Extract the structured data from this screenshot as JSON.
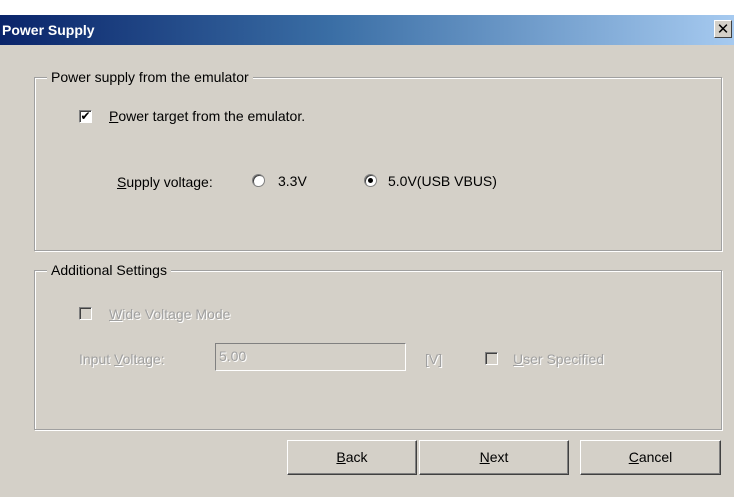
{
  "window": {
    "title": "Power Supply",
    "close_glyph": "✕"
  },
  "group_power": {
    "legend": "Power supply from the emulator",
    "power_target": {
      "key": "P",
      "rest": "ower target from the emulator.",
      "checked": true,
      "check_glyph": "✔"
    },
    "supply_voltage": {
      "label_key": "S",
      "label_rest": "upply voltage:",
      "options": [
        {
          "label": "3.3V",
          "selected": false
        },
        {
          "label": "5.0V(USB VBUS)",
          "selected": true
        }
      ]
    }
  },
  "group_additional": {
    "legend": "Additional Settings",
    "wide_voltage": {
      "key": "W",
      "rest": "ide Voltage Mode",
      "checked": false,
      "enabled": false
    },
    "input_voltage": {
      "label_prefix": "Input ",
      "label_key": "V",
      "label_rest": "oltage:",
      "value": "5.00",
      "unit": "[V]",
      "enabled": false
    },
    "user_specified": {
      "key": "U",
      "rest": "ser Specified",
      "checked": false,
      "enabled": false
    }
  },
  "buttons": {
    "back": {
      "key": "B",
      "rest": "ack"
    },
    "next": {
      "key": "N",
      "rest": "ext"
    },
    "cancel": {
      "key": "C",
      "rest": "ancel"
    }
  },
  "colors": {
    "dialog_bg": "#d4d0c8",
    "title_start": "#0a246a",
    "title_end": "#a6caf0"
  }
}
